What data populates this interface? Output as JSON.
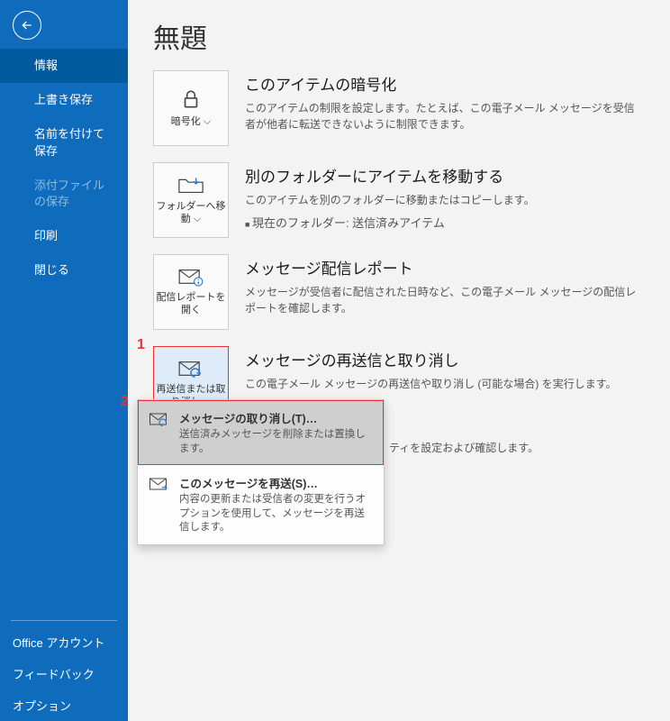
{
  "sidebar": {
    "items": [
      {
        "label": "情報"
      },
      {
        "label": "上書き保存"
      },
      {
        "label": "名前を付けて保存"
      },
      {
        "label": "添付ファイルの保存"
      },
      {
        "label": "印刷"
      },
      {
        "label": "閉じる"
      }
    ],
    "bottom": [
      {
        "label": "Office アカウント"
      },
      {
        "label": "フィードバック"
      },
      {
        "label": "オプション"
      }
    ]
  },
  "page": {
    "title": "無題"
  },
  "sections": {
    "encrypt": {
      "tile": "暗号化 ⌵",
      "heading": "このアイテムの暗号化",
      "desc": "このアイテムの制限を設定します。たとえば、この電子メール メッセージを受信者が他者に転送できないように制限できます。"
    },
    "move": {
      "tile": "フォルダーへ移動 ⌵",
      "heading": "別のフォルダーにアイテムを移動する",
      "desc": "このアイテムを別のフォルダーに移動またはコピーします。",
      "bullet": "現在のフォルダー:   送信済みアイテム"
    },
    "report": {
      "tile": "配信レポートを開く",
      "heading": "メッセージ配信レポート",
      "desc": "メッセージが受信者に配信された日時など、この電子メール メッセージの配信レポートを確認します。"
    },
    "resend": {
      "tile": "再送信または取り消し ⌵",
      "heading": "メッセージの再送信と取り消し",
      "desc": "この電子メール メッセージの再送信や取り消し (可能な場合) を実行します。"
    },
    "partial": "ティを設定および確認します。"
  },
  "callouts": {
    "one": "1",
    "two": "2"
  },
  "menu": {
    "recall": {
      "title": "メッセージの取り消し(T)…",
      "desc": "送信済みメッセージを削除または置換します。"
    },
    "resend": {
      "title": "このメッセージを再送(S)…",
      "desc": "内容の更新または受信者の変更を行うオプションを使用して、メッセージを再送信します。"
    }
  }
}
